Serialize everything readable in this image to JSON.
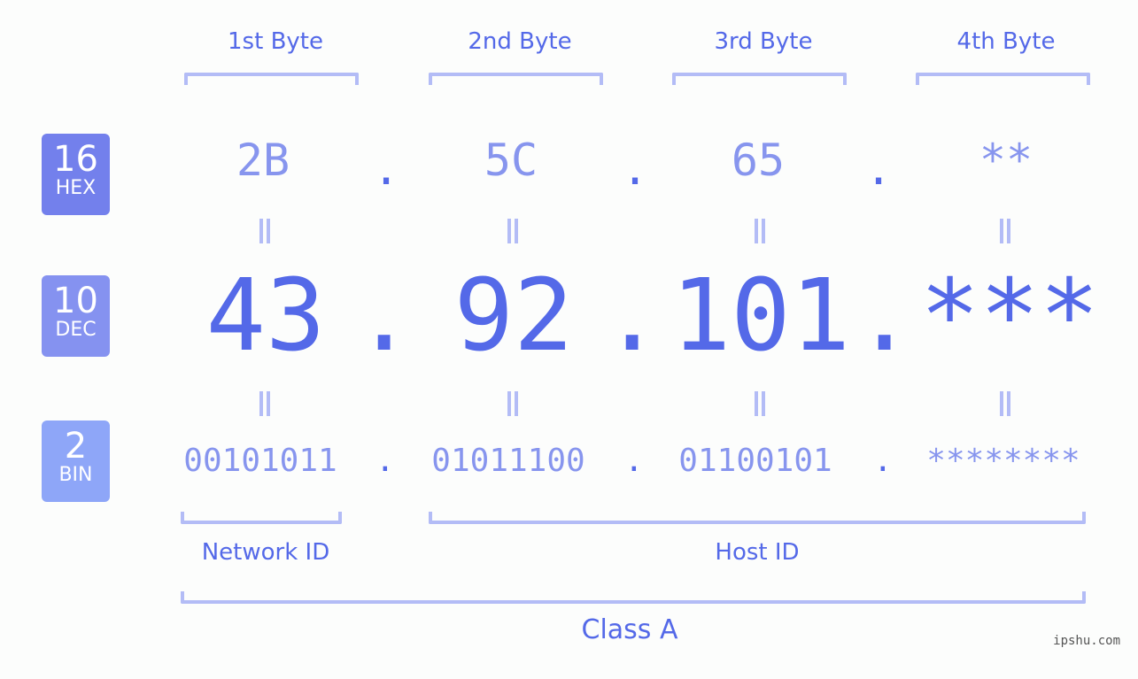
{
  "bytes": [
    "1st Byte",
    "2nd Byte",
    "3rd Byte",
    "4th Byte"
  ],
  "badges": {
    "hex": {
      "num": "16",
      "label": "HEX",
      "color": "#7380ec"
    },
    "dec": {
      "num": "10",
      "label": "DEC",
      "color": "#8592f0"
    },
    "bin": {
      "num": "2",
      "label": "BIN",
      "color": "#8ea6f8"
    }
  },
  "hex": [
    "2B",
    "5C",
    "65",
    "**"
  ],
  "dec": [
    "43",
    "92",
    "101",
    "***"
  ],
  "bin": [
    "00101011",
    "01011100",
    "01100101",
    "********"
  ],
  "separator": ".",
  "network_id": "Network ID",
  "host_id": "Host ID",
  "class_label": "Class A",
  "watermark": "ipshu.com",
  "colors": {
    "primary": "#5469e8",
    "light": "#8795ee",
    "bracket": "#b3bcf6"
  }
}
